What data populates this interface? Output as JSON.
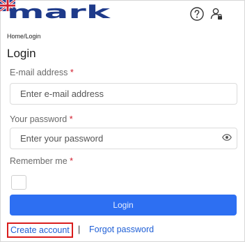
{
  "header": {
    "logo_text": "mark",
    "icons": [
      "help-icon",
      "user-icon",
      "uk-flag-icon"
    ]
  },
  "breadcrumb": {
    "home": "Home",
    "separator": "/",
    "current": "Login"
  },
  "page": {
    "title": "Login"
  },
  "form": {
    "email": {
      "label": "E-mail address",
      "required_mark": "*",
      "placeholder": "Enter e-mail address",
      "value": ""
    },
    "password": {
      "label": "Your password",
      "required_mark": "*",
      "placeholder": "Enter your password",
      "value": "",
      "toggle_icon": "eye-icon"
    },
    "remember": {
      "label": "Remember me",
      "required_mark": "*",
      "checked": false
    },
    "submit_label": "Login"
  },
  "links": {
    "create_account": "Create account",
    "separator": "|",
    "forgot_password": "Forgot password"
  },
  "colors": {
    "brand": "#1e3a8a",
    "primary_button": "#2d6ff2",
    "link": "#1f5fd6",
    "required": "#d11a2a",
    "highlight_box": "#d91c1c"
  }
}
